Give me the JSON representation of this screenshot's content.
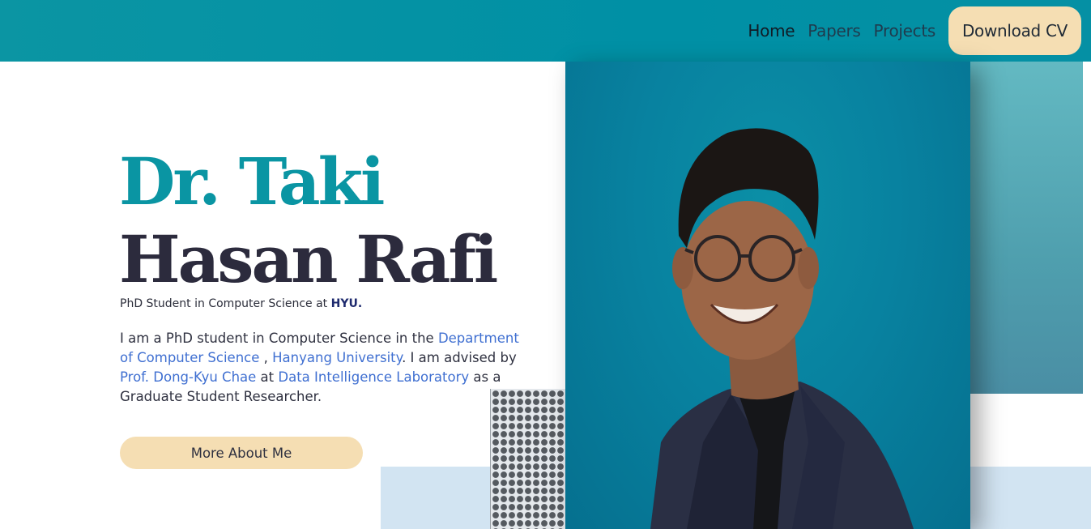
{
  "nav": {
    "links": [
      {
        "label": "Home"
      },
      {
        "label": "Papers"
      },
      {
        "label": "Projects"
      }
    ],
    "cv_label": "Download CV"
  },
  "hero": {
    "title_line1": "Dr. Taki",
    "title_line2": "Hasan Rafi",
    "subtitle_prefix": "PhD Student in Computer Science at ",
    "subtitle_uni": "HYU.",
    "bio": {
      "t1": "I am a PhD student in Computer Science in the ",
      "link_department": "Department of Computer Science",
      "t2": " , ",
      "link_university": "Hanyang University",
      "t3": ". I am advised by ",
      "link_advisor": "Prof. Dong-Kyu Chae",
      "t4": " at ",
      "link_lab": "Data Intelligence Laboratory",
      "t5": " as a Graduate Student Researcher."
    },
    "more_button": "More About Me"
  },
  "colors": {
    "navbar": "#0090a5",
    "accent_teal": "#0a95a3",
    "button_bg": "#f5deb3",
    "link": "#3f6fd1",
    "title_dark": "#2c2b3d"
  }
}
